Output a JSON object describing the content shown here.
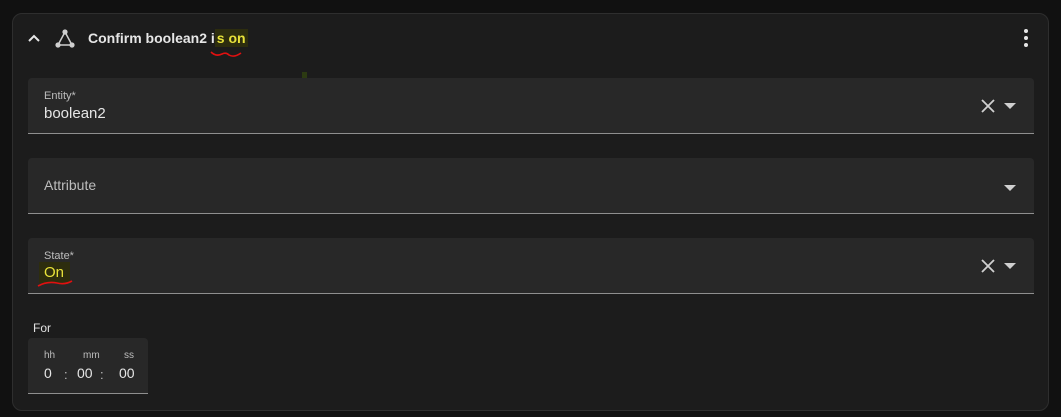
{
  "header": {
    "title_prefix": "Confirm boolean2 i",
    "title_highlight": "s on",
    "expand_icon": "chevron-up-icon",
    "trigger_icon": "graph-node-icon",
    "menu_icon": "dots-vertical-icon"
  },
  "fields": {
    "entity": {
      "label": "Entity*",
      "value": "boolean2"
    },
    "attribute": {
      "label": "Attribute"
    },
    "state": {
      "label": "State*",
      "value": "On"
    }
  },
  "duration": {
    "label": "For",
    "units": {
      "hh": "hh",
      "mm": "mm",
      "ss": "ss"
    },
    "values": {
      "hh": "0",
      "mm": "00",
      "ss": "00"
    },
    "separator": ":"
  },
  "colors": {
    "background": "#111111",
    "card": "#1c1c1c",
    "field": "#282828",
    "highlight_text": "#e8e23a",
    "annotation_red": "#e01010"
  }
}
